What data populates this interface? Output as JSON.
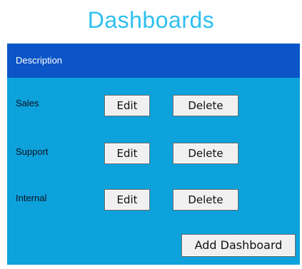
{
  "page": {
    "title": "Dashboards"
  },
  "table": {
    "header": {
      "description_label": "Description"
    },
    "rows": [
      {
        "name": "Sales",
        "edit_label": "Edit",
        "delete_label": "Delete"
      },
      {
        "name": "Support",
        "edit_label": "Edit",
        "delete_label": "Delete"
      },
      {
        "name": "Internal",
        "edit_label": "Edit",
        "delete_label": "Delete"
      }
    ],
    "add_label": "Add Dashboard"
  },
  "colors": {
    "title": "#2ec0ee",
    "panel_background": "#0da2db",
    "header_background": "#0b55c8",
    "button_background": "#f0f0f0"
  }
}
